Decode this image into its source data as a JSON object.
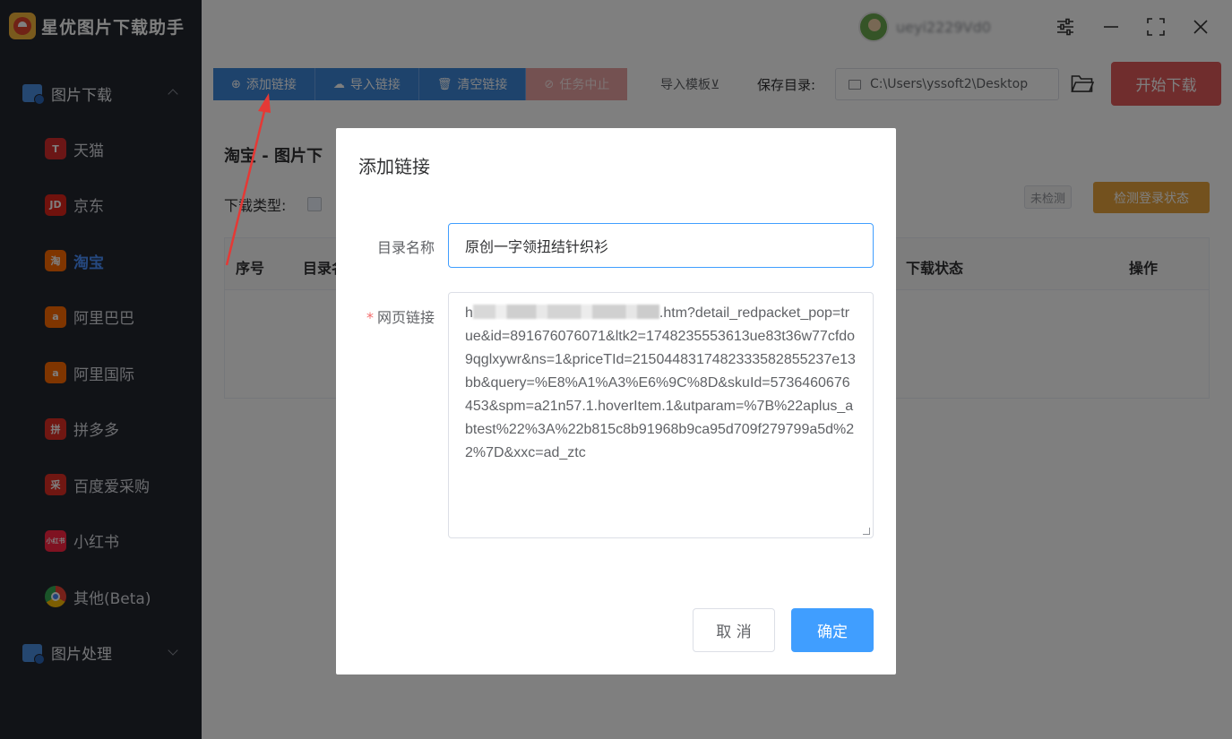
{
  "app": {
    "title": "星优图片下载助手"
  },
  "sidebar": {
    "groups": [
      {
        "label": "图片下载",
        "expanded": true
      },
      {
        "label": "图片处理",
        "expanded": false
      }
    ],
    "items": [
      {
        "label": "天猫",
        "icon": "tmall-icon",
        "icon_text": "T",
        "color": "#d62c2c"
      },
      {
        "label": "京东",
        "icon": "jd-icon",
        "icon_text": "JD",
        "color": "#e1251b"
      },
      {
        "label": "淘宝",
        "icon": "taobao-icon",
        "icon_text": "淘",
        "color": "#ff6a00",
        "active": true
      },
      {
        "label": "阿里巴巴",
        "icon": "alibaba-icon",
        "icon_text": "a",
        "color": "#ff6a00"
      },
      {
        "label": "阿里国际",
        "icon": "alibaba-intl-icon",
        "icon_text": "a",
        "color": "#ff6a00"
      },
      {
        "label": "拼多多",
        "icon": "pinduoduo-icon",
        "icon_text": "拼",
        "color": "#e02e24"
      },
      {
        "label": "百度爱采购",
        "icon": "baidu-aicaigou-icon",
        "icon_text": "采",
        "color": "#e02e24"
      },
      {
        "label": "小红书",
        "icon": "xiaohongshu-icon",
        "icon_text": "小红书",
        "color": "#ff2442"
      },
      {
        "label": "其他(Beta)",
        "icon": "chrome-icon",
        "icon_text": "",
        "color": "#ffffff"
      }
    ]
  },
  "titlebar": {
    "username": "ueyi2229Vd0"
  },
  "toolbar": {
    "add_link": "添加链接",
    "import_link": "导入链接",
    "clear_link": "清空链接",
    "stop_task": "任务中止",
    "import_template": "导入模板⊻",
    "save_dir_label": "保存目录:",
    "save_dir_value": "C:\\Users\\yssoft2\\Desktop",
    "start_download": "开始下载"
  },
  "content": {
    "page_title": "淘宝 - 图片下",
    "download_type_label": "下载类型:",
    "status_badge": "未检测",
    "check_login_button": "检测登录状态",
    "table_headers": [
      "序号",
      "目录名",
      "下载状态",
      "操作"
    ]
  },
  "dialog": {
    "title": "添加链接",
    "dir_name_label": "目录名称",
    "dir_name_value": "原创一字领扭结针织衫",
    "url_label": "网页链接",
    "url_prefix": "h",
    "url_value": ".htm?detail_redpacket_pop=true&id=891676076071&ltk2=1748235553613ue83t36w77cfdo9qglxywr&ns=1&priceTId=2150448317482333582855237e13bb&query=%E8%A1%A3%E6%9C%8D&skuId=5736460676453&spm=a21n57.1.hoverItem.1&utparam=%7B%22aplus_abtest%22%3A%22b815c8b91968b9ca95d709f279799a5d%22%7D&xxc=ad_ztc",
    "cancel": "取 消",
    "confirm": "确定"
  },
  "colors": {
    "sidebar_bg": "#23262f",
    "primary": "#409eff",
    "toolbar_blue": "#3c86d9",
    "start_red": "#e05a5a",
    "warning": "#e6a23c",
    "annotation_arrow": "#e53935"
  }
}
